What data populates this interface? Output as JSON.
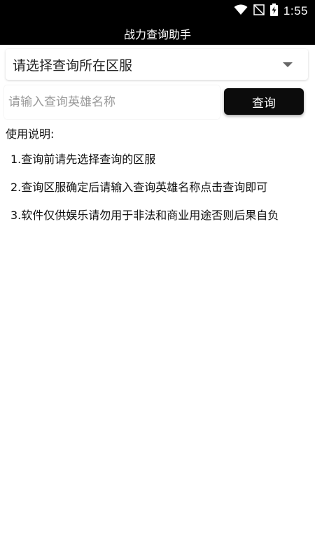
{
  "status_bar": {
    "time": "1:55",
    "icons": [
      "wifi-icon",
      "no-signal-icon",
      "battery-charging-icon"
    ]
  },
  "app_bar": {
    "title": "战力查询助手"
  },
  "region_select": {
    "selected": "请选择查询所在区服"
  },
  "search": {
    "placeholder": "请输入查询英雄名称",
    "value": "",
    "button_label": "查询"
  },
  "instructions": {
    "heading": "使用说明:",
    "items": [
      "1.查询前请先选择查询的区服",
      "2.查询区服确定后请输入查询英雄名称点击查询即可",
      "3.软件仅供娱乐请勿用于非法和商业用途否则后果自负"
    ]
  },
  "colors": {
    "bar_background": "#000000",
    "button_background": "#0c0c0c",
    "page_background": "#ffffff"
  }
}
